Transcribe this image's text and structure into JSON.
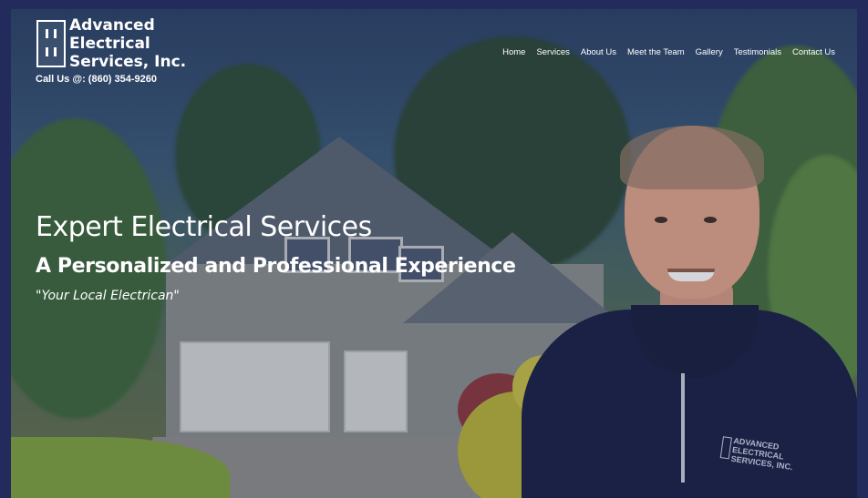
{
  "brand": {
    "line1": "Advanced",
    "line2": "Electrical",
    "line3": "Services, Inc.",
    "logo_icon": "electrical-outlet-icon"
  },
  "contact": {
    "phone_text": "Call Us @: (860) 354-9260"
  },
  "nav": {
    "items": [
      "Home",
      "Services",
      "About Us",
      "Meet the Team",
      "Gallery",
      "Testimonials",
      "Contact Us"
    ]
  },
  "hero": {
    "heading": "Expert Electrical Services",
    "subheading": "A Personalized and Professional Experience",
    "tagline": "\"Your Local Electrican\"",
    "shirt_logo_lines": [
      "ADVANCED",
      "ELECTRICAL",
      "SERVICES, INC."
    ]
  },
  "colors": {
    "frame": "#232a5c",
    "text": "#ffffff",
    "jacket": "#1c2346"
  }
}
